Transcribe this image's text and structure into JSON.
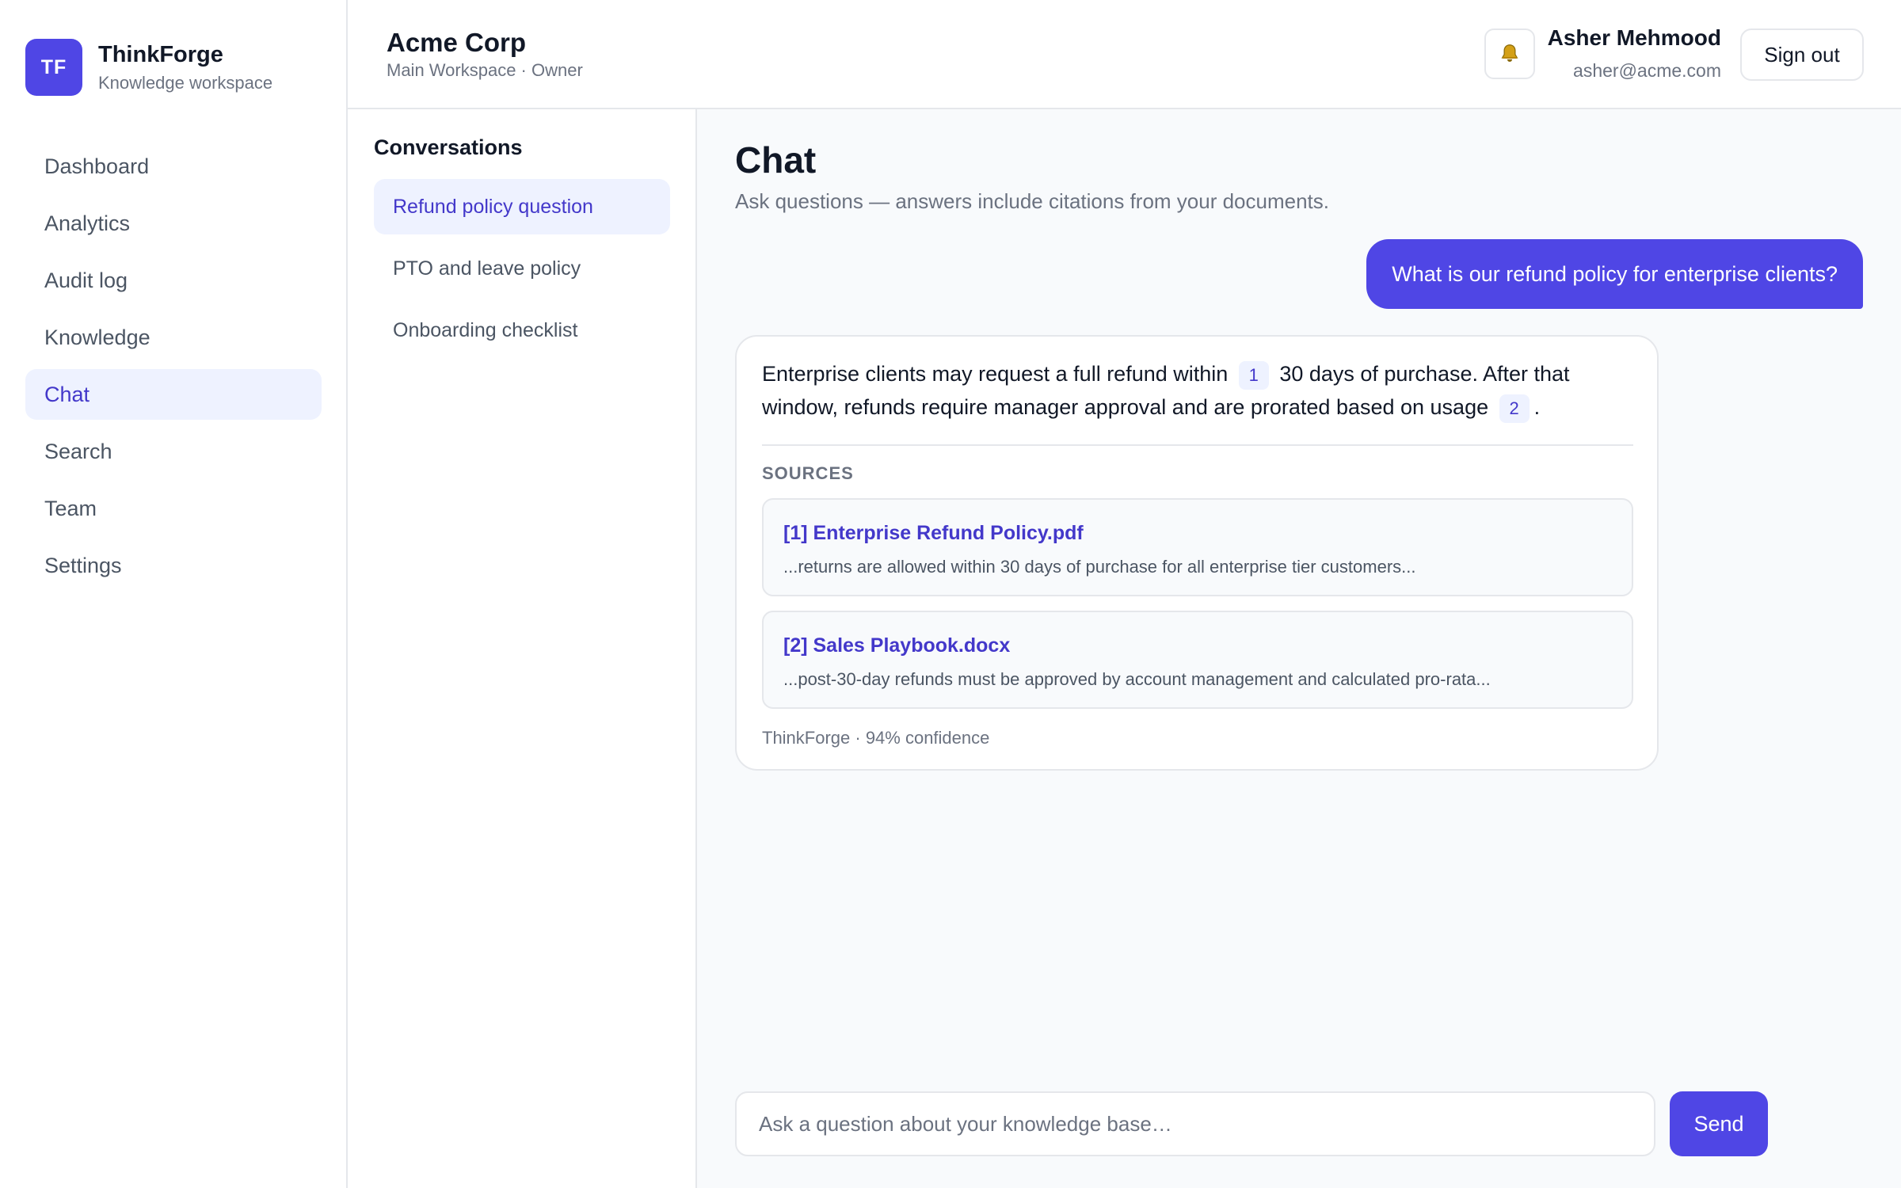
{
  "brand": {
    "logo_text": "TF",
    "name": "ThinkForge",
    "subtitle": "Knowledge workspace",
    "accent_color": "#4f46e5"
  },
  "sidebar": {
    "items": [
      {
        "label": "Dashboard",
        "active": false
      },
      {
        "label": "Analytics",
        "active": false
      },
      {
        "label": "Audit log",
        "active": false
      },
      {
        "label": "Knowledge",
        "active": false
      },
      {
        "label": "Chat",
        "active": true
      },
      {
        "label": "Search",
        "active": false
      },
      {
        "label": "Team",
        "active": false
      },
      {
        "label": "Settings",
        "active": false
      }
    ]
  },
  "header": {
    "org_name": "Acme Corp",
    "org_sub": "Main Workspace · Owner",
    "bell_icon": "bell-icon",
    "user_name": "Asher Mehmood",
    "user_email": "asher@acme.com",
    "signout_label": "Sign out"
  },
  "conversations": {
    "title": "Conversations",
    "items": [
      {
        "label": "Refund policy question",
        "active": true
      },
      {
        "label": "PTO and leave policy",
        "active": false
      },
      {
        "label": "Onboarding checklist",
        "active": false
      }
    ]
  },
  "chat": {
    "title": "Chat",
    "subtitle": "Ask questions — answers include citations from your documents.",
    "user_message": "What is our refund policy for enterprise clients?",
    "answer": {
      "part1": "Enterprise clients may request a full refund within",
      "cite1": "1",
      "part2": "30 days of purchase. After that window, refunds require manager approval and are prorated based on usage",
      "cite2": "2",
      "part3": ".",
      "sources_label": "SOURCES",
      "sources": [
        {
          "title": "[1] Enterprise Refund Policy.pdf",
          "snippet": "...returns are allowed within 30 days of purchase for all enterprise tier customers..."
        },
        {
          "title": "[2] Sales Playbook.docx",
          "snippet": "...post-30-day refunds must be approved by account management and calculated pro-rata..."
        }
      ],
      "meta": "ThinkForge · 94% confidence"
    }
  },
  "composer": {
    "placeholder": "Ask a question about your knowledge base…",
    "send_label": "Send"
  }
}
